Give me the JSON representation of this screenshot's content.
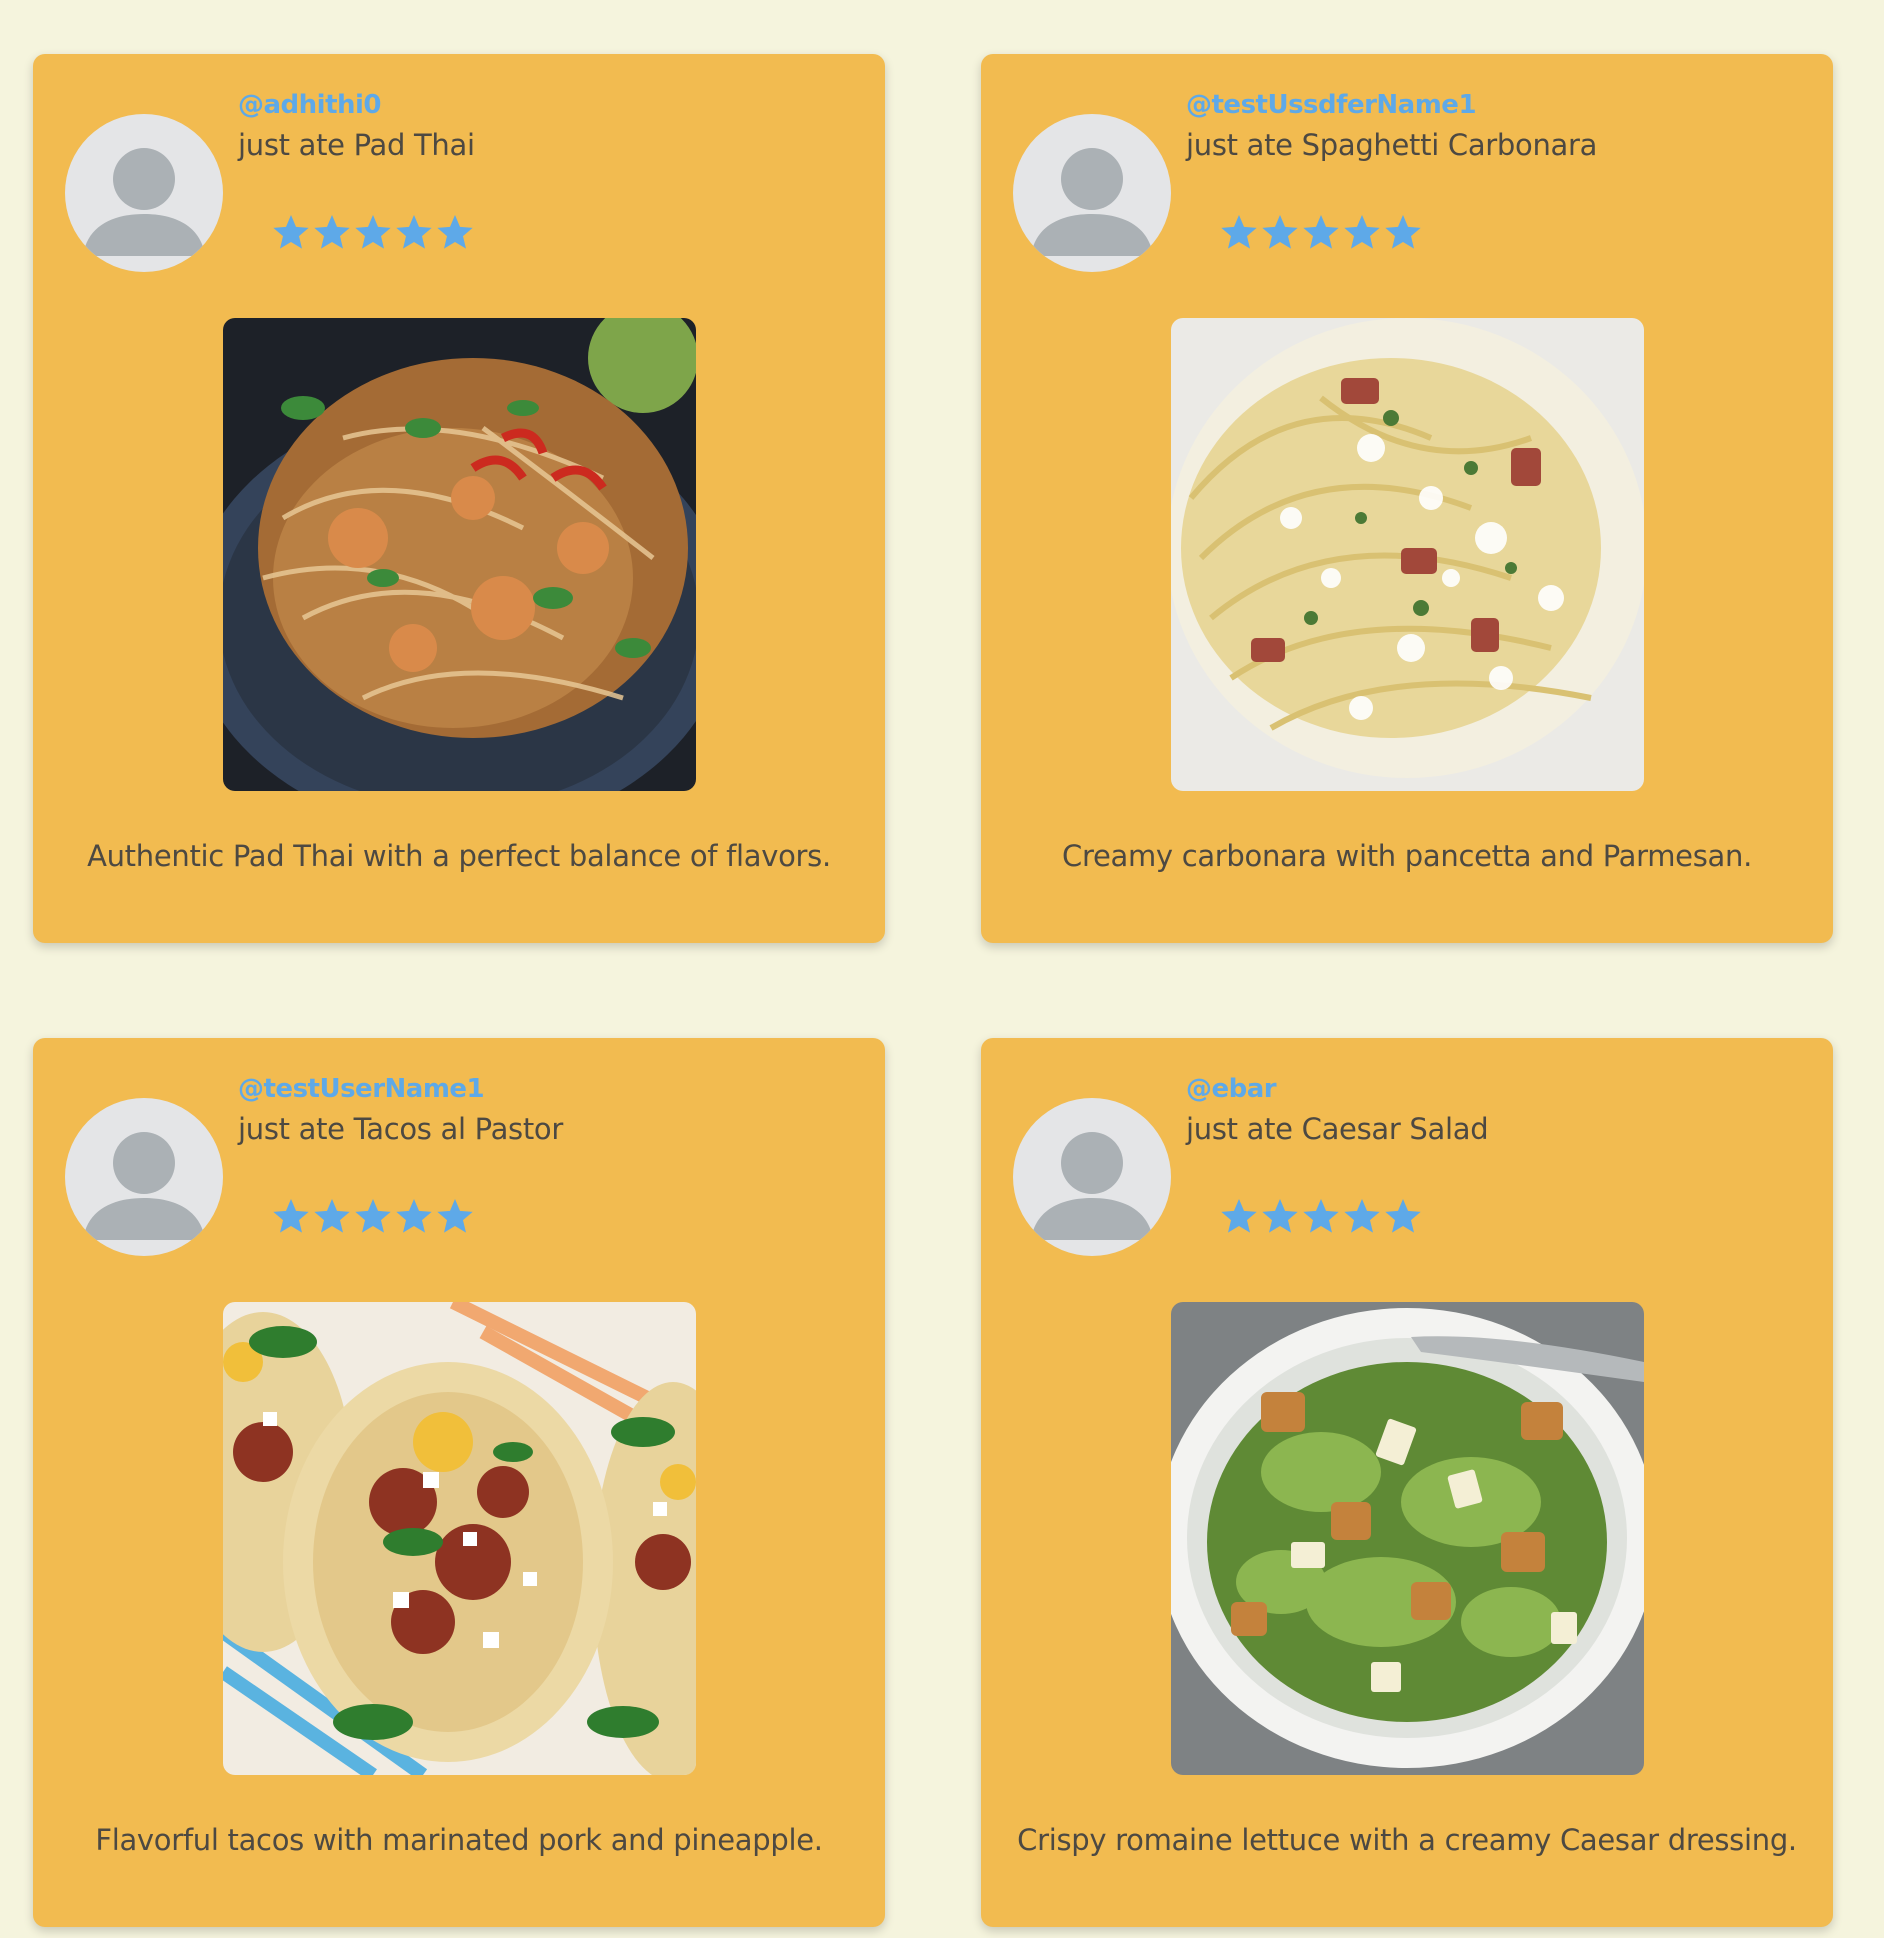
{
  "theme": {
    "background": "#f5f4dd",
    "card": "#f2bb50",
    "username_color": "#5ea9e8",
    "text_color": "#4d4942",
    "star_color": "#5ea9e8"
  },
  "posts": [
    {
      "username": "@adhithi0",
      "action": "just ate Pad Thai",
      "rating": 5,
      "photo_icon": "pad-thai-photo",
      "description": "Authentic Pad Thai with a perfect balance of flavors."
    },
    {
      "username": "@testUssdferName1",
      "action": "just ate Spaghetti Carbonara",
      "rating": 5,
      "photo_icon": "carbonara-photo",
      "description": "Creamy carbonara with pancetta and Parmesan."
    },
    {
      "username": "@testUserName1",
      "action": "just ate Tacos al Pastor",
      "rating": 5,
      "photo_icon": "tacos-photo",
      "description": "Flavorful tacos with marinated pork and pineapple."
    },
    {
      "username": "@ebar",
      "action": "just ate Caesar Salad",
      "rating": 5,
      "photo_icon": "caesar-salad-photo",
      "description": "Crispy romaine lettuce with a creamy Caesar dressing."
    }
  ]
}
